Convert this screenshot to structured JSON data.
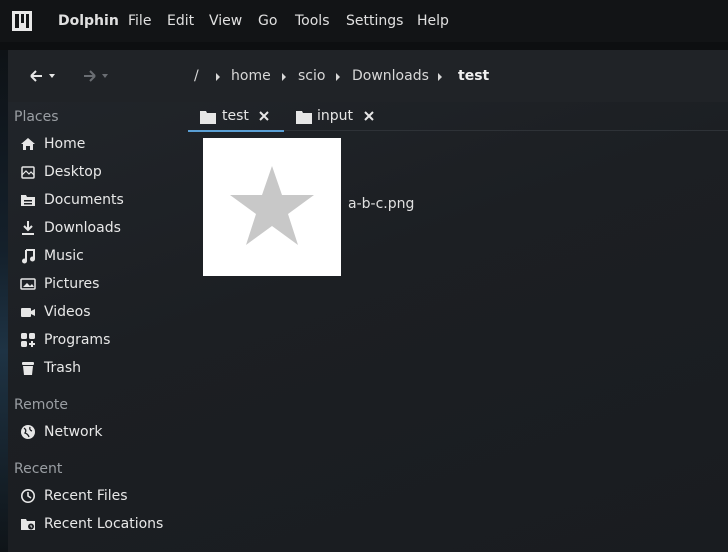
{
  "menubar": {
    "app_name": "Dolphin",
    "items": [
      "File",
      "Edit",
      "View",
      "Go",
      "Tools",
      "Settings",
      "Help"
    ]
  },
  "breadcrumb": {
    "root": "/",
    "parts": [
      "home",
      "scio",
      "Downloads"
    ],
    "current": "test"
  },
  "sidebar": {
    "places_title": "Places",
    "places": [
      {
        "label": "Home",
        "icon": "home-icon"
      },
      {
        "label": "Desktop",
        "icon": "desktop-icon"
      },
      {
        "label": "Documents",
        "icon": "documents-icon"
      },
      {
        "label": "Downloads",
        "icon": "downloads-icon"
      },
      {
        "label": "Music",
        "icon": "music-icon"
      },
      {
        "label": "Pictures",
        "icon": "pictures-icon"
      },
      {
        "label": "Videos",
        "icon": "videos-icon"
      },
      {
        "label": "Programs",
        "icon": "programs-icon"
      },
      {
        "label": "Trash",
        "icon": "trash-icon"
      }
    ],
    "remote_title": "Remote",
    "remote": [
      {
        "label": "Network",
        "icon": "network-icon"
      }
    ],
    "recent_title": "Recent",
    "recent": [
      {
        "label": "Recent Files",
        "icon": "recent-files-icon"
      },
      {
        "label": "Recent Locations",
        "icon": "recent-locations-icon"
      }
    ]
  },
  "tabs": [
    {
      "label": "test",
      "active": true
    },
    {
      "label": "input",
      "active": false
    }
  ],
  "files": [
    {
      "name": "a-b-c.png",
      "thumbnail": "star-icon"
    }
  ],
  "colors": {
    "accent": "#5a9fd4",
    "background": "#1c1f23",
    "menubar": "#121416"
  }
}
